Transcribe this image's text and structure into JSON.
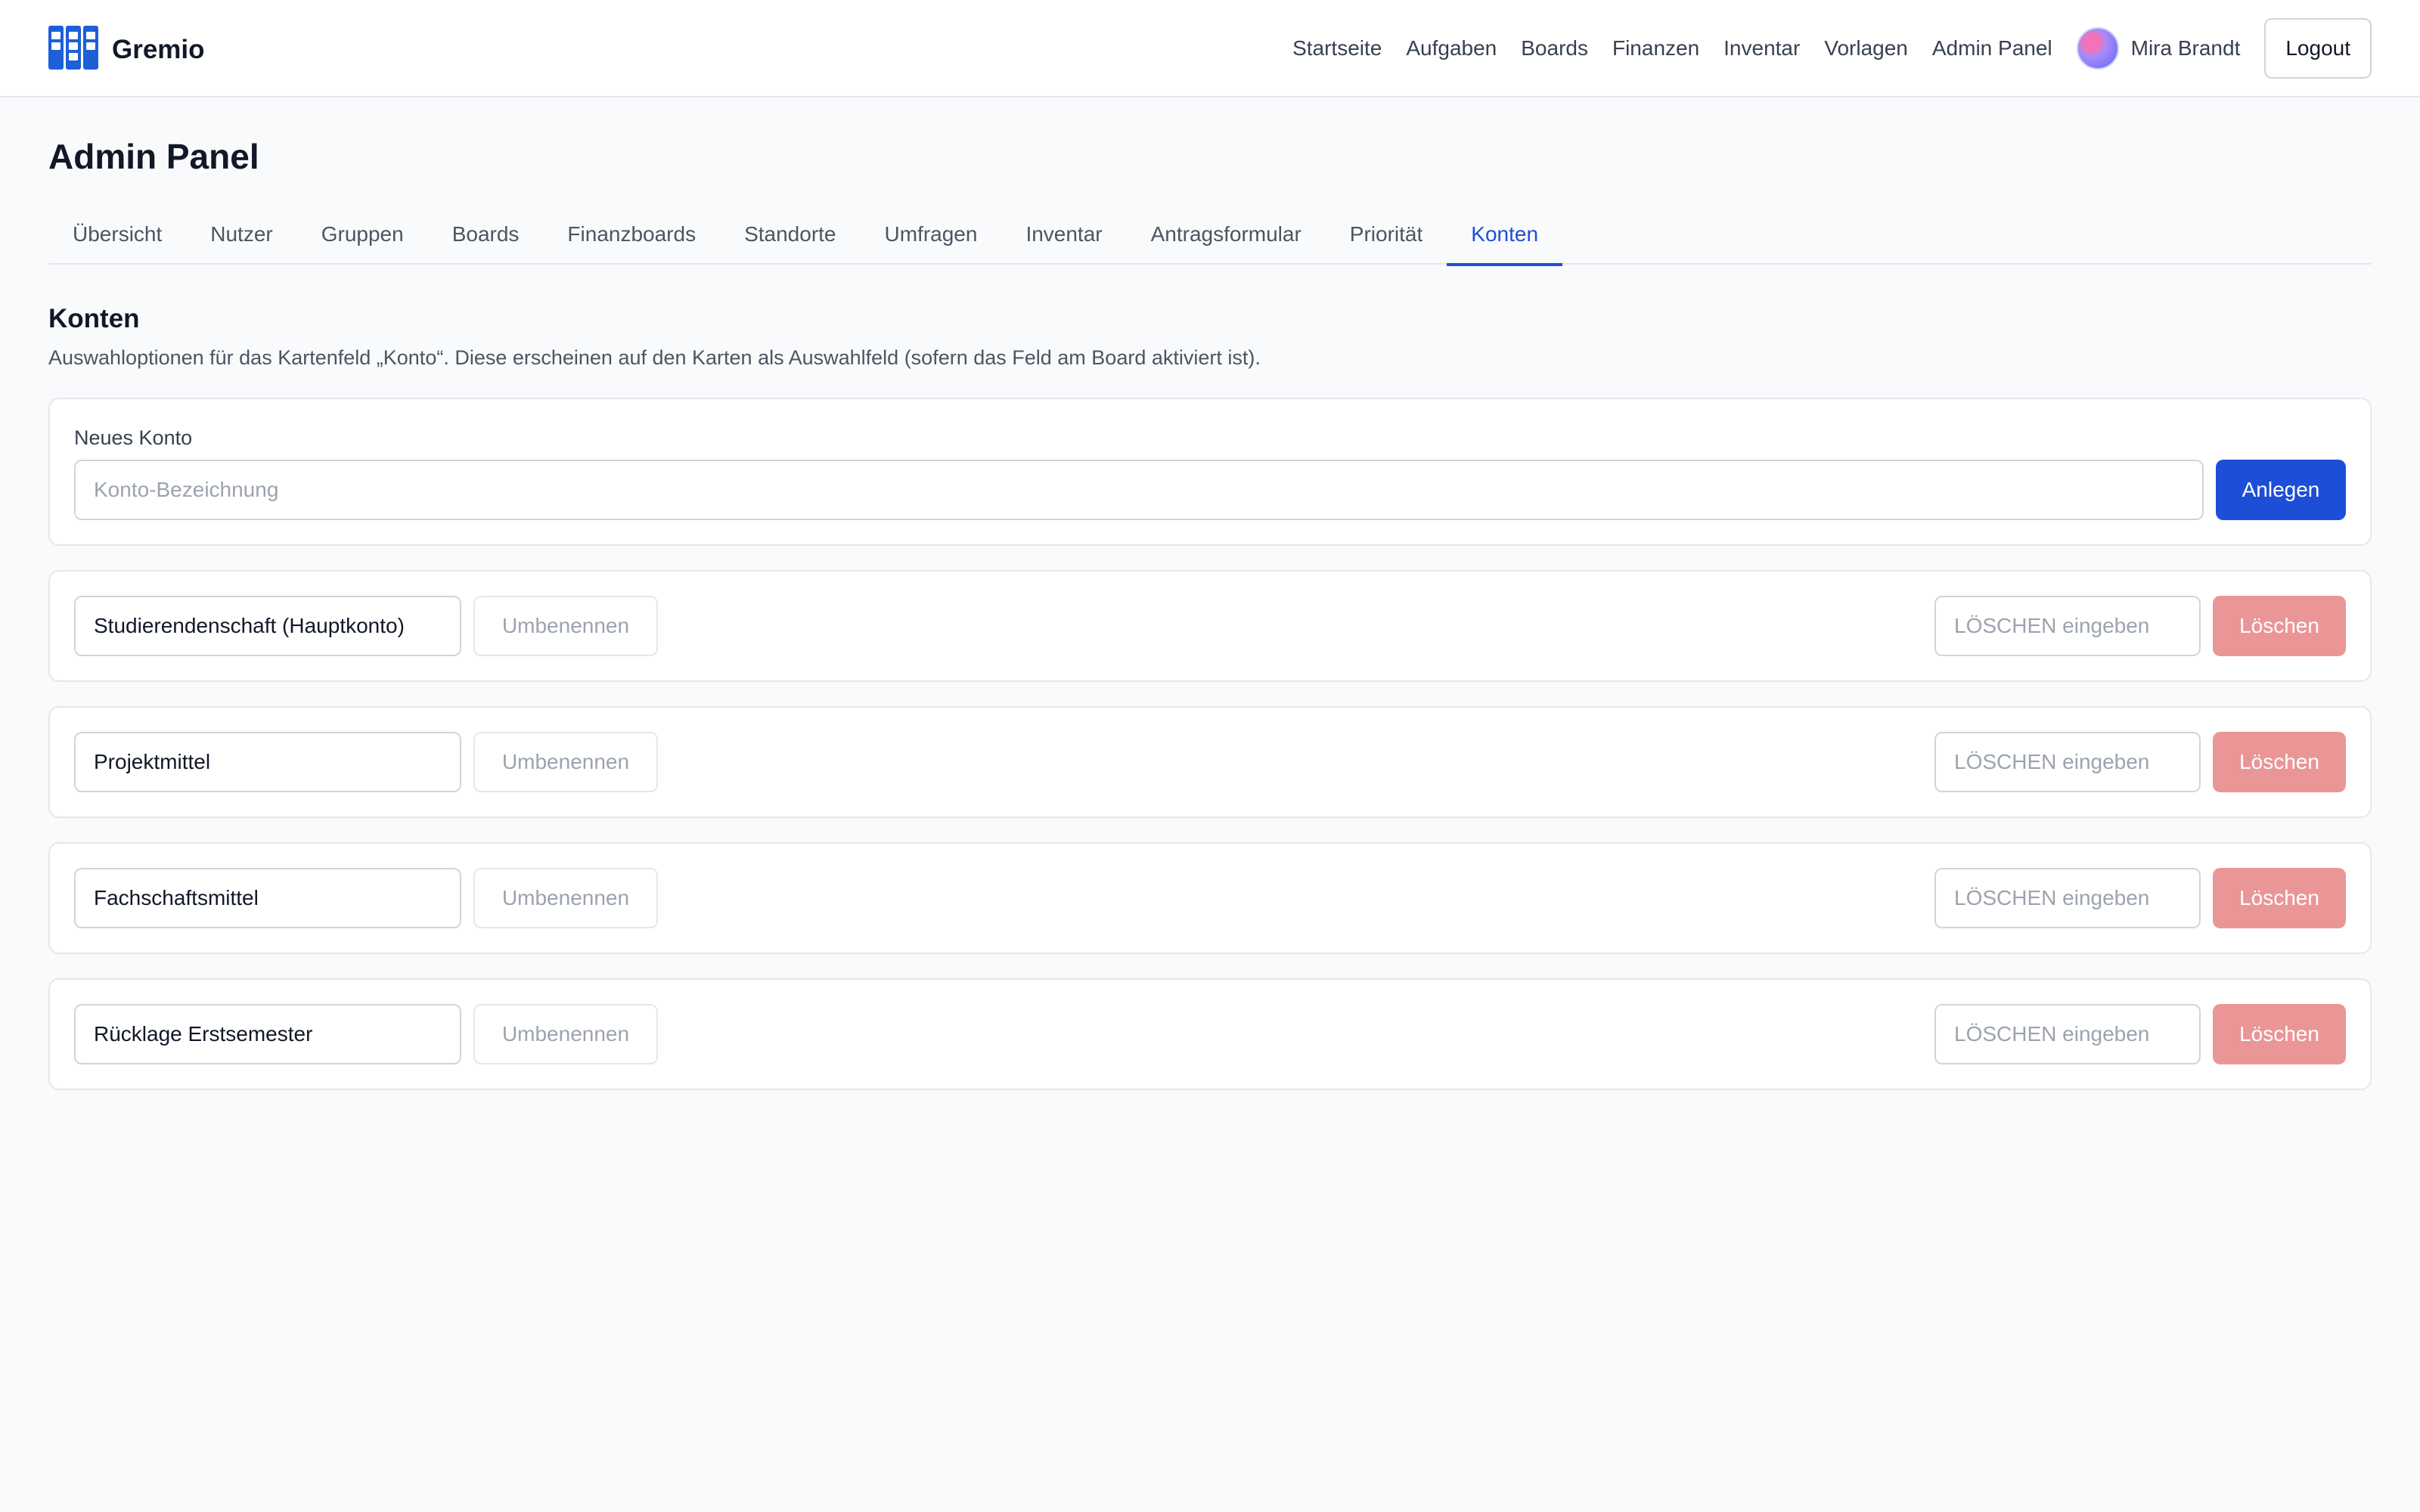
{
  "app": {
    "name": "Gremio"
  },
  "nav": {
    "links": [
      "Startseite",
      "Aufgaben",
      "Boards",
      "Finanzen",
      "Inventar",
      "Vorlagen",
      "Admin Panel"
    ],
    "user_name": "Mira Brandt",
    "logout_label": "Logout"
  },
  "page": {
    "title": "Admin Panel"
  },
  "tabs": [
    "Übersicht",
    "Nutzer",
    "Gruppen",
    "Boards",
    "Finanzboards",
    "Standorte",
    "Umfragen",
    "Inventar",
    "Antragsformular",
    "Priorität",
    "Konten"
  ],
  "active_tab": "Konten",
  "section": {
    "title": "Konten",
    "description": "Auswahloptionen für das Kartenfeld „Konto“. Diese erscheinen auf den Karten als Auswahlfeld (sofern das Feld am Board aktiviert ist)."
  },
  "new_account": {
    "label": "Neues Konto",
    "placeholder": "Konto-Bezeichnung",
    "value": "",
    "create_label": "Anlegen"
  },
  "accounts": [
    {
      "name": "Studierendenschaft (Hauptkonto)",
      "rename_label": "Umbenennen",
      "confirm_placeholder": "LÖSCHEN eingeben",
      "delete_label": "Löschen"
    },
    {
      "name": "Projektmittel",
      "rename_label": "Umbenennen",
      "confirm_placeholder": "LÖSCHEN eingeben",
      "delete_label": "Löschen"
    },
    {
      "name": "Fachschaftsmittel",
      "rename_label": "Umbenennen",
      "confirm_placeholder": "LÖSCHEN eingeben",
      "delete_label": "Löschen"
    },
    {
      "name": "Rücklage Erstsemester",
      "rename_label": "Umbenennen",
      "confirm_placeholder": "LÖSCHEN eingeben",
      "delete_label": "Löschen"
    }
  ],
  "colors": {
    "primary": "#1d4ed8",
    "danger_disabled": "#ea9696",
    "border": "#e5e7eb",
    "background": "#f9fafb"
  },
  "icons": {
    "logo": "kanban-board-icon"
  }
}
